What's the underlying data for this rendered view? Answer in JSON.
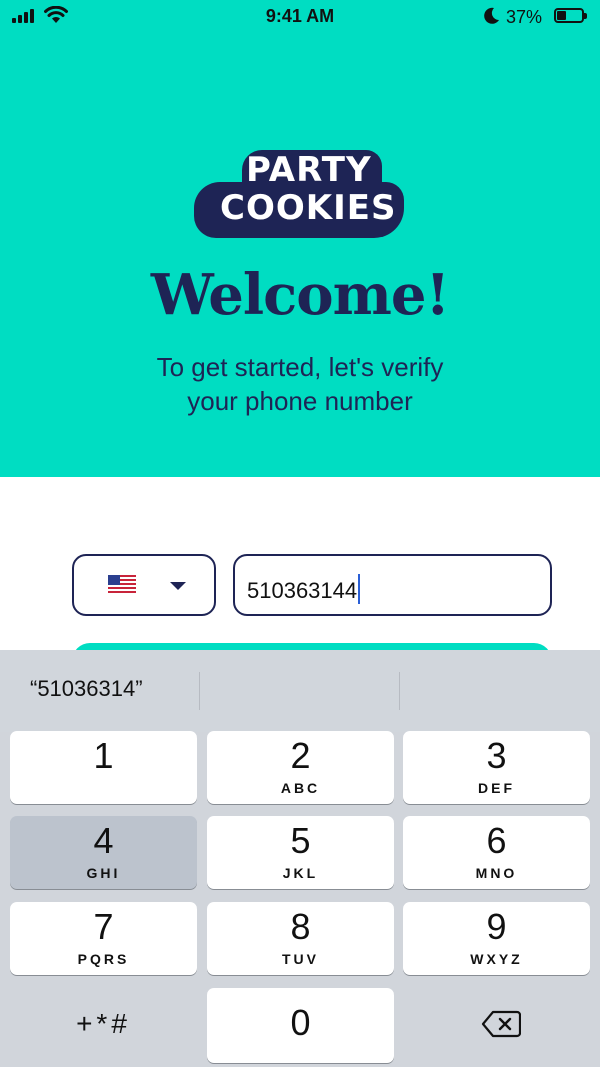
{
  "status_bar": {
    "time": "9:41 AM",
    "battery": "37%",
    "battery_level": 0.37
  },
  "hero": {
    "logo_line1": "PARTY",
    "logo_line2": "COOKIES",
    "title": "Welcome!",
    "subtitle_line1": "To get started, let's verify",
    "subtitle_line2": "your phone number"
  },
  "form": {
    "country_flag": "us-flag-icon",
    "phone_value": "510363144"
  },
  "keyboard": {
    "suggestion": "“51036314”",
    "keys": [
      {
        "num": "1",
        "letters": ""
      },
      {
        "num": "2",
        "letters": "ABC"
      },
      {
        "num": "3",
        "letters": "DEF"
      },
      {
        "num": "4",
        "letters": "GHI"
      },
      {
        "num": "5",
        "letters": "JKL"
      },
      {
        "num": "6",
        "letters": "MNO"
      },
      {
        "num": "7",
        "letters": "PQRS"
      },
      {
        "num": "8",
        "letters": "TUV"
      },
      {
        "num": "9",
        "letters": "WXYZ"
      },
      {
        "num": "0",
        "letters": ""
      }
    ],
    "symbols": "+*#"
  },
  "colors": {
    "accent": "#00ddc2",
    "navy": "#1e2455",
    "pressed_key": "#bcc3cd"
  }
}
